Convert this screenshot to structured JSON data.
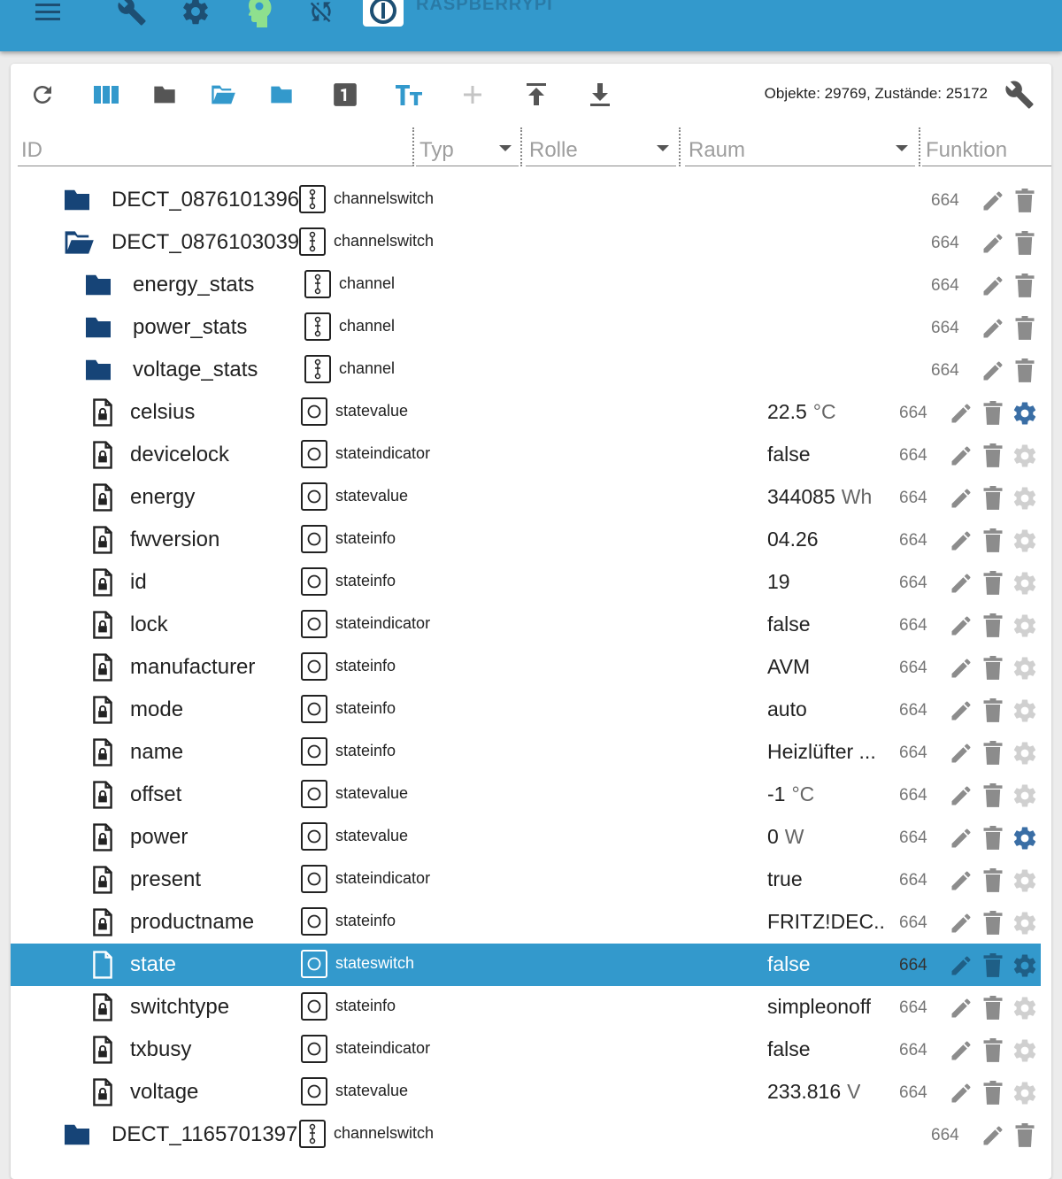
{
  "appbar": {
    "brand": "RASPBERRYPI",
    "icons": [
      "menu-icon",
      "wrench-icon",
      "gear-icon",
      "head-icon",
      "sync-disabled-icon",
      "iobroker-logo"
    ]
  },
  "toolbar": {
    "counts": "Objekte: 29769, Zustände: 25172",
    "icons": [
      "refresh-icon",
      "columns-icon",
      "folder-icon",
      "folder-open-icon",
      "folder-icon",
      "number-one-icon",
      "text-size-icon",
      "plus-icon",
      "upload-icon",
      "download-icon"
    ]
  },
  "filters": {
    "id_placeholder": "ID",
    "typ": "Typ",
    "rolle": "Rolle",
    "raum": "Raum",
    "funktion": "Funktion"
  },
  "colors": {
    "primary": "#3399cc",
    "folder": "#164477",
    "gear_active": "#3a6ea5",
    "gear_inactive": "#d0d0d0",
    "action_grey": "#8c8c8c"
  },
  "rows": [
    {
      "name": "DECT_0876101396",
      "kind": "folder",
      "role": "channelswitch",
      "value": "",
      "acl": "664",
      "gear": "none"
    },
    {
      "name": "DECT_0876103039",
      "kind": "folder-open",
      "role": "channelswitch",
      "value": "",
      "acl": "664",
      "gear": "none"
    },
    {
      "name": "energy_stats",
      "kind": "folder",
      "role": "channel",
      "value": "",
      "acl": "664",
      "gear": "none"
    },
    {
      "name": "power_stats",
      "kind": "folder",
      "role": "channel",
      "value": "",
      "acl": "664",
      "gear": "none"
    },
    {
      "name": "voltage_stats",
      "kind": "folder",
      "role": "channel",
      "value": "",
      "acl": "664",
      "gear": "none"
    },
    {
      "name": "celsius",
      "kind": "state",
      "role": "statevalue",
      "value": "22.5",
      "unit": "°C",
      "acl": "664",
      "gear": "active"
    },
    {
      "name": "devicelock",
      "kind": "state",
      "role": "stateindicator",
      "value": "false",
      "unit": "",
      "acl": "664",
      "gear": "inactive"
    },
    {
      "name": "energy",
      "kind": "state",
      "role": "statevalue",
      "value": "344085",
      "unit": "Wh",
      "acl": "664",
      "gear": "inactive"
    },
    {
      "name": "fwversion",
      "kind": "state",
      "role": "stateinfo",
      "value": "04.26",
      "unit": "",
      "acl": "664",
      "gear": "inactive"
    },
    {
      "name": "id",
      "kind": "state",
      "role": "stateinfo",
      "value": "19",
      "unit": "",
      "acl": "664",
      "gear": "inactive"
    },
    {
      "name": "lock",
      "kind": "state",
      "role": "stateindicator",
      "value": "false",
      "unit": "",
      "acl": "664",
      "gear": "inactive"
    },
    {
      "name": "manufacturer",
      "kind": "state",
      "role": "stateinfo",
      "value": "AVM",
      "unit": "",
      "acl": "664",
      "gear": "inactive"
    },
    {
      "name": "mode",
      "kind": "state",
      "role": "stateinfo",
      "value": "auto",
      "unit": "",
      "acl": "664",
      "gear": "inactive"
    },
    {
      "name": "name",
      "kind": "state",
      "role": "stateinfo",
      "value": "Heizlüfter ...",
      "unit": "",
      "acl": "664",
      "gear": "inactive"
    },
    {
      "name": "offset",
      "kind": "state",
      "role": "statevalue",
      "value": "-1",
      "unit": "°C",
      "acl": "664",
      "gear": "inactive"
    },
    {
      "name": "power",
      "kind": "state",
      "role": "statevalue",
      "value": "0",
      "unit": "W",
      "acl": "664",
      "gear": "active"
    },
    {
      "name": "present",
      "kind": "state",
      "role": "stateindicator",
      "value": "true",
      "unit": "",
      "acl": "664",
      "gear": "inactive"
    },
    {
      "name": "productname",
      "kind": "state",
      "role": "stateinfo",
      "value": "FRITZ!DEC...",
      "unit": "",
      "acl": "664",
      "gear": "inactive"
    },
    {
      "name": "state",
      "kind": "state-selected",
      "role": "stateswitch",
      "value": "false",
      "unit": "",
      "acl": "664",
      "gear": "active"
    },
    {
      "name": "switchtype",
      "kind": "state",
      "role": "stateinfo",
      "value": "simpleonoff",
      "unit": "",
      "acl": "664",
      "gear": "inactive"
    },
    {
      "name": "txbusy",
      "kind": "state",
      "role": "stateindicator",
      "value": "false",
      "unit": "",
      "acl": "664",
      "gear": "inactive"
    },
    {
      "name": "voltage",
      "kind": "state",
      "role": "statevalue",
      "value": "233.816",
      "unit": "V",
      "acl": "664",
      "gear": "inactive"
    },
    {
      "name": "DECT_1165701397",
      "kind": "folder",
      "role": "channelswitch",
      "value": "",
      "acl": "664",
      "gear": "none"
    }
  ]
}
